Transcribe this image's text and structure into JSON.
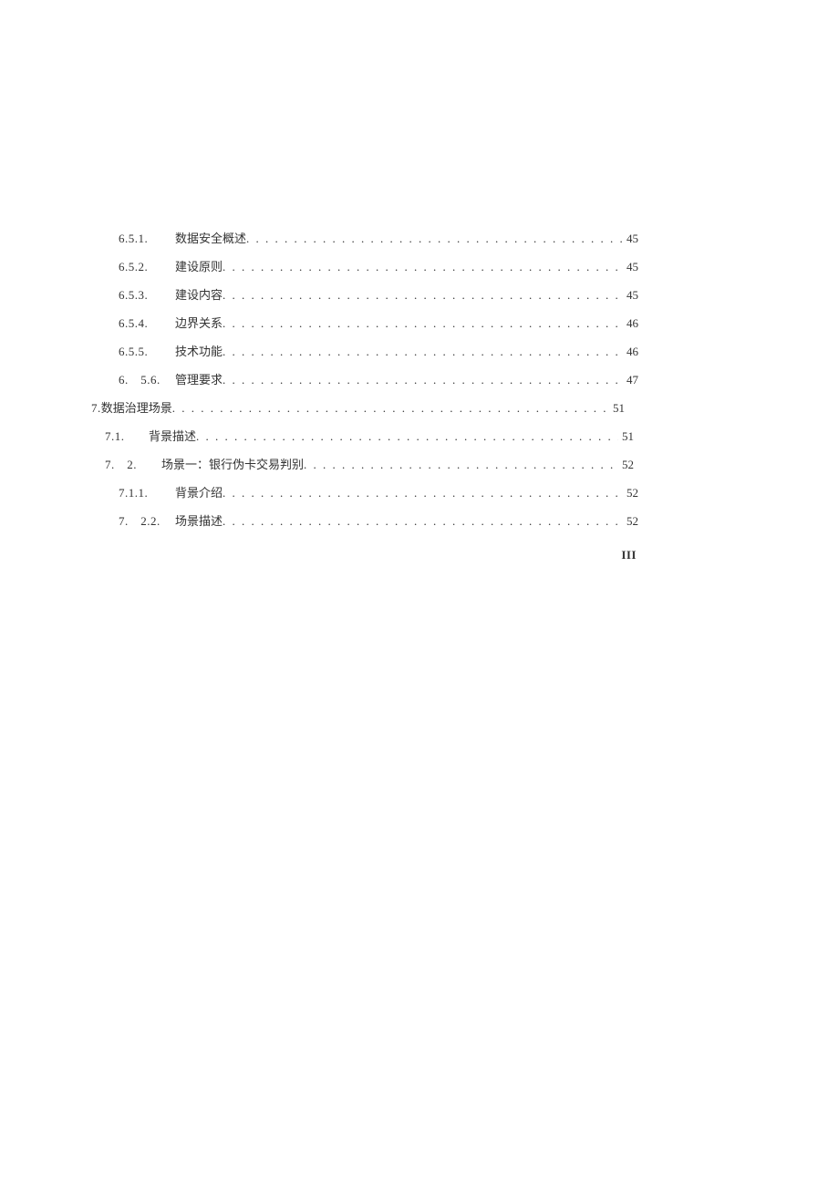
{
  "toc": [
    {
      "indent": "indent-3",
      "num": "6.5.1.",
      "title": "数据安全概述",
      "page": "45"
    },
    {
      "indent": "indent-3",
      "num": "6.5.2.",
      "title": "建设原则",
      "page": "45"
    },
    {
      "indent": "indent-3",
      "num": "6.5.3.",
      "title": "建设内容",
      "page": "45"
    },
    {
      "indent": "indent-3",
      "num": "6.5.4.",
      "title": "边界关系",
      "page": "46"
    },
    {
      "indent": "indent-3",
      "num": "6.5.5.",
      "title": "技术功能",
      "page": "46"
    },
    {
      "indent": "indent-3",
      "num": "6.　5.6.",
      "title": "管理要求",
      "page": "47"
    },
    {
      "indent": "indent-1",
      "num": "7.",
      "title": "数据治理场景",
      "page": "51"
    },
    {
      "indent": "indent-2",
      "num": "7.1.",
      "title": "背景描述",
      "page": "51"
    },
    {
      "indent": "indent-2b",
      "num": "7.　2.",
      "title": "场景一：银行伪卡交易判别",
      "page": "52"
    },
    {
      "indent": "indent-3",
      "num": "7.1.1.",
      "title": "背景介绍",
      "page": "52"
    },
    {
      "indent": "indent-3",
      "num": "7.　2.2.",
      "title": "场景描述",
      "page": "52"
    }
  ],
  "page_number": "III"
}
